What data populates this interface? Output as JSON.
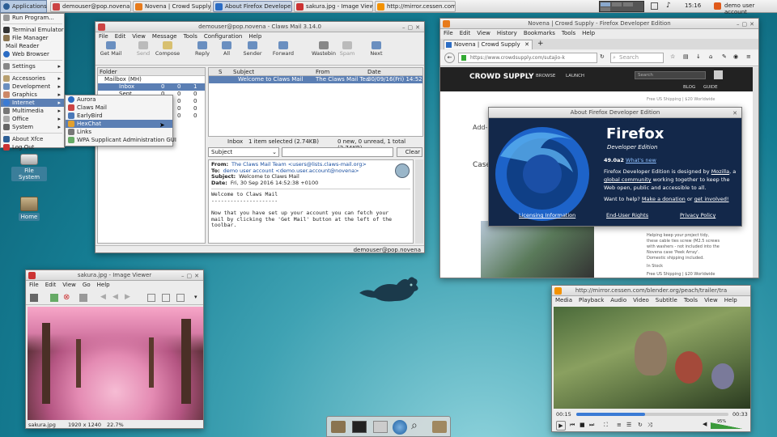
{
  "panel": {
    "apps_label": "Applications",
    "tasks": [
      {
        "label": "demouser@pop.novena..."
      },
      {
        "label": "Novena | Crowd Supply ..."
      },
      {
        "label": "About Firefox Developer..."
      },
      {
        "label": "sakura.jpg - Image Viewer"
      },
      {
        "label": "http://mirror.cessen.com..."
      }
    ],
    "clock": "15:16",
    "user": "demo user account"
  },
  "app_menu": {
    "items": [
      "Run Program...",
      "Terminal Emulator",
      "File Manager",
      "Mail Reader",
      "Web Browser",
      "Settings",
      "Accessories",
      "Development",
      "Graphics",
      "Internet",
      "Multimedia",
      "Office",
      "System",
      "About Xfce",
      "Log Out"
    ],
    "internet_sub": [
      "Aurora",
      "Claws Mail",
      "EarlyBird",
      "HexChat",
      "Links",
      "WPA Supplicant Administration GUI"
    ]
  },
  "desktop": {
    "file_system": "File System",
    "home": "Home"
  },
  "claws": {
    "title": "demouser@pop.novena - Claws Mail 3.14.0",
    "menu": [
      "File",
      "Edit",
      "View",
      "Message",
      "Tools",
      "Configuration",
      "Help"
    ],
    "toolbar": [
      "Get Mail",
      "Send",
      "Compose",
      "Reply",
      "All",
      "Sender",
      "Forward",
      "Wastebin",
      "Spam",
      "Next"
    ],
    "folder_header": "Folder",
    "folders": [
      {
        "name": "Mailbox (MH)",
        "n": "",
        "u": "",
        "t": ""
      },
      {
        "name": "Inbox",
        "n": "0",
        "u": "0",
        "t": "1"
      },
      {
        "name": "Sent",
        "n": "0",
        "u": "0",
        "t": "0"
      },
      {
        "name": "",
        "n": "0",
        "u": "0",
        "t": "0"
      },
      {
        "name": "",
        "n": "0",
        "u": "0",
        "t": "0"
      },
      {
        "name": "",
        "n": "0",
        "u": "0",
        "t": "0"
      }
    ],
    "list_cols": [
      "S",
      "Subject",
      "From",
      "Date"
    ],
    "msg_subject": "Welcome to Claws Mail",
    "msg_from": "The Claws Mail Tea",
    "msg_date": "30/09/16(Fri) 14:52",
    "status_folder": "Inbox",
    "status_sel": "1 item selected (2.74KB)",
    "status_counts": "0 new, 0 unread, 1 total (2.74KB)",
    "filter_label": "Subject",
    "clear": "Clear",
    "hdr_from_k": "From:",
    "hdr_from_v": "The Claws Mail Team <users@lists.claws-mail.org>",
    "hdr_to_k": "To:",
    "hdr_to_v": "demo user account <demo.user.account@novena>",
    "hdr_subj_k": "Subject:",
    "hdr_subj_v": "Welcome to Claws Mail",
    "hdr_date_k": "Date:",
    "hdr_date_v": "Fri, 30 Sep 2016 14:52:38 +0100",
    "body1": "Welcome to Claws Mail",
    "body2": "---------------------",
    "body3": "Now that you have set up your account you can fetch your",
    "body4": "mail by clicking the 'Get Mail' button at the left of the",
    "body5": "toolbar.",
    "footer": "demouser@pop.novena"
  },
  "firefox": {
    "title": "Novena | Crowd Supply - Firefox Developer Edition",
    "menu": [
      "File",
      "Edit",
      "View",
      "History",
      "Bookmarks",
      "Tools",
      "Help"
    ],
    "tab": "Novena | Crowd Supply",
    "url": "https://www.crowdsupply.com/sutajio-k",
    "search_ph": "Search",
    "site_logo": "CROWD SUPPLY",
    "nav": [
      "BROWSE",
      "LAUNCH"
    ],
    "nav2": [
      "BLOG",
      "GUIDE"
    ],
    "site_search": "Search",
    "side_text": [
      "Helping keep your project tidy,",
      "these cable ties screw (M2.5 screws",
      "with washers - not included into the",
      "Novena case 'Peek Array'.",
      "Domestic shipping included."
    ],
    "in_stock": "In Stock",
    "price_note": "Free US Shipping | $20 Worldwide",
    "left_head": [
      "Add-",
      "Case"
    ]
  },
  "about": {
    "title": "About Firefox Developer Edition",
    "brand": "Firefox",
    "edition": "Developer Edition",
    "version": "49.0a2",
    "whats_new": "What's new",
    "line1": "Firefox Developer Edition is designed by",
    "mozilla": "Mozilla",
    "line2": "global community",
    "line2b": "working together to keep the",
    "line3": "Web open, public and accessible to all.",
    "help_a": "Want to help?",
    "donation": "Make a donation",
    "or": "or",
    "get_involved": "get involved!",
    "links": [
      "Licensing Information",
      "End-User Rights",
      "Privacy Policy"
    ]
  },
  "viewer": {
    "title": "sakura.jpg - Image Viewer",
    "menu": [
      "File",
      "Edit",
      "View",
      "Go",
      "Help"
    ],
    "status_name": "sakura.jpg",
    "status_dim": "1920 x 1240",
    "status_zoom": "22.7%"
  },
  "vlc": {
    "title": "http://mirror.cessen.com/blender.org/peach/trailer/tra",
    "menu": [
      "Media",
      "Playback",
      "Audio",
      "Video",
      "Subtitle",
      "Tools",
      "View",
      "Help"
    ],
    "time_cur": "00:15",
    "time_total": "00:33",
    "progress": 0.45,
    "volume": "95%"
  },
  "colors": {
    "accent": "#5b7fb4",
    "ff_blue": "#1a4fa0"
  }
}
